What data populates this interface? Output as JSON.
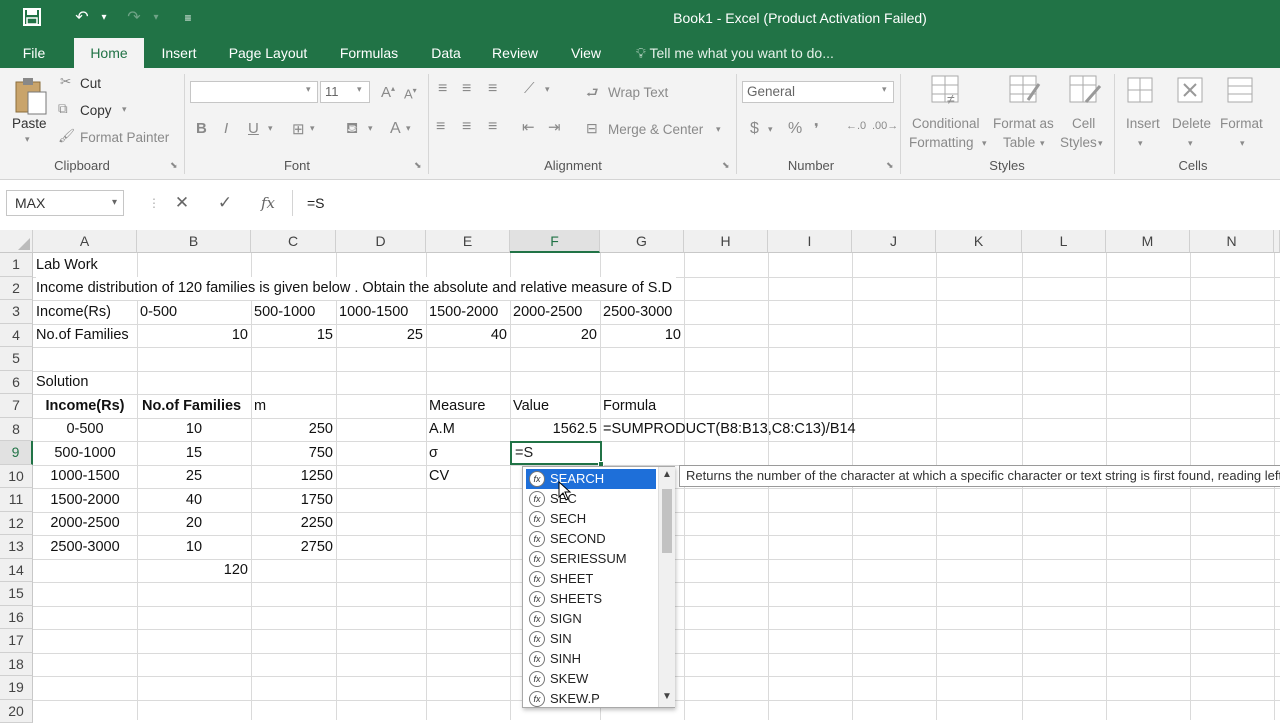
{
  "window": {
    "title": "Book1 - Excel (Product Activation Failed)"
  },
  "quick_access": {
    "save_icon": "save-icon",
    "undo_icon": "undo-icon",
    "redo_icon": "redo-icon",
    "customize_icon": "customize-qat-icon"
  },
  "tabs": [
    "File",
    "Home",
    "Insert",
    "Page Layout",
    "Formulas",
    "Data",
    "Review",
    "View"
  ],
  "active_tab": "Home",
  "tell_me": "Tell me what you want to do...",
  "ribbon": {
    "clipboard": {
      "paste": "Paste",
      "cut": "Cut",
      "copy": "Copy",
      "format_painter": "Format Painter",
      "label": "Clipboard"
    },
    "font": {
      "font_name": "",
      "font_size": "11",
      "bold": "B",
      "italic": "I",
      "underline": "U",
      "font_color": "A",
      "label": "Font"
    },
    "alignment": {
      "wrap_text": "Wrap Text",
      "merge_center": "Merge & Center",
      "label": "Alignment"
    },
    "number": {
      "format": "General",
      "currency": "$",
      "percent": "%",
      "label": "Number"
    },
    "styles": {
      "conditional": "Conditional",
      "conditional2": "Formatting",
      "format_as": "Format as",
      "format_as2": "Table",
      "cell_styles": "Cell",
      "cell_styles2": "Styles",
      "label": "Styles"
    },
    "cells": {
      "insert": "Insert",
      "delete": "Delete",
      "format": "Format",
      "label": "Cells"
    }
  },
  "formula_bar": {
    "name_box": "MAX",
    "cancel": "✕",
    "enter": "✓",
    "fx": "fx",
    "content": "=S"
  },
  "columns": [
    "A",
    "B",
    "C",
    "D",
    "E",
    "F",
    "G",
    "H",
    "I",
    "J",
    "K",
    "L",
    "M",
    "N"
  ],
  "rows": [
    "1",
    "2",
    "3",
    "4",
    "5",
    "6",
    "7",
    "8",
    "9",
    "10",
    "11",
    "12",
    "13",
    "14",
    "15",
    "16",
    "17",
    "18",
    "19",
    "20"
  ],
  "cells": {
    "a1": "Lab Work",
    "a2": "Income distribution of 120 families is given below . Obtain the absolute and relative measure of S.D",
    "a3": "Income(Rs)",
    "b3": "0-500",
    "c3": "500-1000",
    "d3": "1000-1500",
    "e3": "1500-2000",
    "f3": "2000-2500",
    "g3": "2500-3000",
    "a4": "No.of Families",
    "b4": "10",
    "c4": "15",
    "d4": "25",
    "e4": "40",
    "f4": "20",
    "g4": "10",
    "a6": "Solution",
    "a7": "Income(Rs)",
    "b7": "No.of Families",
    "c7": "m",
    "e7": "Measure",
    "f7": "Value",
    "g7": "Formula",
    "a8": "0-500",
    "b8": "10",
    "c8": "250",
    "e8": "A.M",
    "f8": "1562.5",
    "g8": "=SUMPRODUCT(B8:B13,C8:C13)/B14",
    "a9": "500-1000",
    "b9": "15",
    "c9": "750",
    "e9": "σ",
    "f9": "=S",
    "a10": "1000-1500",
    "b10": "25",
    "c10": "1250",
    "e10": "CV",
    "a11": "1500-2000",
    "b11": "40",
    "c11": "1750",
    "a12": "2000-2500",
    "b12": "20",
    "c12": "2250",
    "a13": "2500-3000",
    "b13": "10",
    "c13": "2750",
    "b14": "120"
  },
  "autocomplete": {
    "items": [
      "SEARCH",
      "SEC",
      "SECH",
      "SECOND",
      "SERIESSUM",
      "SHEET",
      "SHEETS",
      "SIGN",
      "SIN",
      "SINH",
      "SKEW",
      "SKEW.P"
    ],
    "selected": "SEARCH",
    "icon_text": "fx",
    "tooltip": "Returns the number of the character at which a specific character or text string is first found, reading left to right (not case-sensitive)"
  }
}
